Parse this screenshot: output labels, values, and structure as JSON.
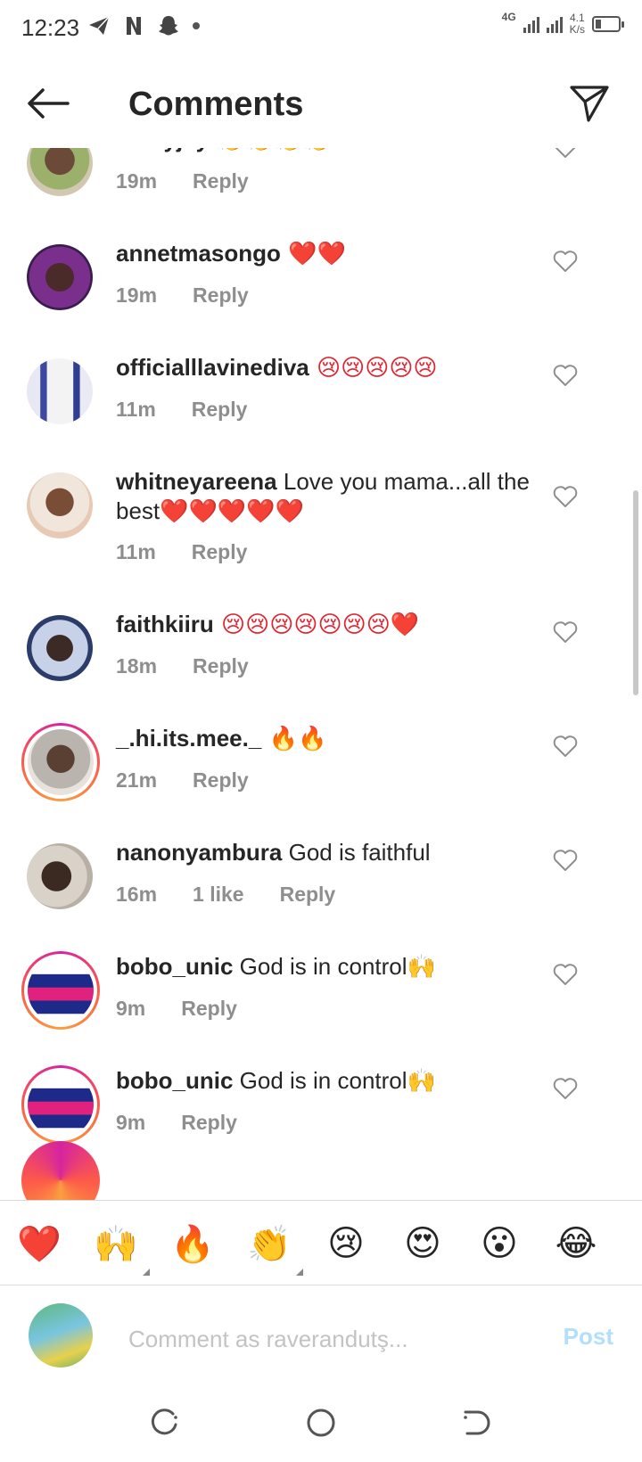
{
  "status_bar": {
    "time": "12:23",
    "network": "4G",
    "speed_value": "4.1",
    "speed_unit": "K/s"
  },
  "header": {
    "title": "Comments"
  },
  "comments": [
    {
      "username": "lennyjay",
      "text": "",
      "emoji": "👏👏👏👏",
      "time": "19m",
      "likes": "",
      "reply": "Reply"
    },
    {
      "username": "annetmasongo",
      "text": "",
      "emoji": "❤️❤️",
      "time": "19m",
      "likes": "",
      "reply": "Reply"
    },
    {
      "username": "officialllavinediva",
      "text": "",
      "emoji": "😢😢😢😢😢",
      "time": "11m",
      "likes": "",
      "reply": "Reply"
    },
    {
      "username": "whitneyareena",
      "text": "Love you mama...all the best",
      "emoji": "❤️❤️❤️❤️❤️",
      "time": "11m",
      "likes": "",
      "reply": "Reply"
    },
    {
      "username": "faithkiiru",
      "text": "",
      "emoji": "😢😢😢😢😢😢😢❤️",
      "time": "18m",
      "likes": "",
      "reply": "Reply"
    },
    {
      "username": "_.hi.its.mee._",
      "text": "",
      "emoji": "🔥🔥",
      "time": "21m",
      "likes": "",
      "reply": "Reply"
    },
    {
      "username": "nanonyambura",
      "text": "God is faithful",
      "emoji": "",
      "time": "16m",
      "likes": "1 like",
      "reply": "Reply"
    },
    {
      "username": "bobo_unic",
      "text": "God is in control",
      "emoji": "🙌",
      "time": "9m",
      "likes": "",
      "reply": "Reply"
    },
    {
      "username": "bobo_unic",
      "text": "God is in control",
      "emoji": "🙌",
      "time": "9m",
      "likes": "",
      "reply": "Reply"
    }
  ],
  "reactions": [
    "❤️",
    "🙌",
    "🔥",
    "👏",
    "😢",
    "😍",
    "😮",
    "😂"
  ],
  "compose": {
    "placeholder": "Comment as raverandutş...",
    "post_label": "Post"
  },
  "colors": {
    "text": "#262626",
    "meta": "#8e8e8e",
    "post_disabled": "#b2dffc",
    "heart": "#e0242f"
  }
}
